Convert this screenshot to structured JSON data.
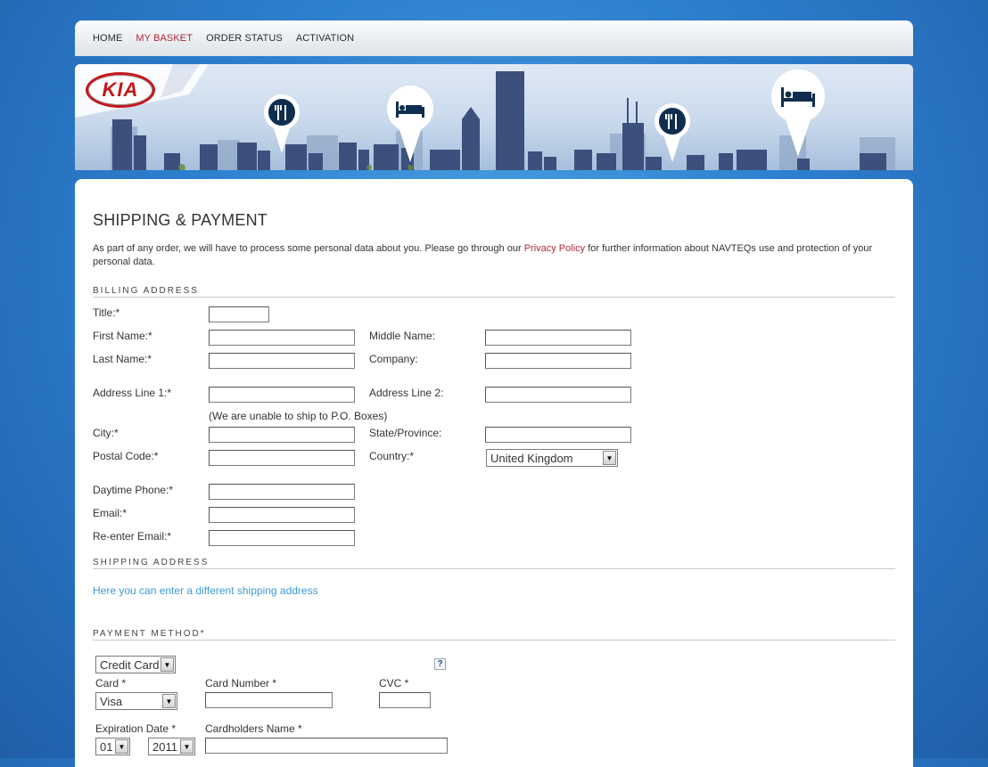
{
  "nav": {
    "items": [
      {
        "label": "HOME",
        "active": false
      },
      {
        "label": "MY BASKET",
        "active": true
      },
      {
        "label": "ORDER STATUS",
        "active": false
      },
      {
        "label": "ACTIVATION",
        "active": false
      }
    ]
  },
  "banner": {
    "logo_text": "KIA"
  },
  "page": {
    "title": "SHIPPING & PAYMENT",
    "intro_before": "As part of any order, we will have to process some personal data about you. Please go through our ",
    "intro_link": "Privacy Policy",
    "intro_after": " for further information about NAVTEQs use and protection of your personal data."
  },
  "billing": {
    "heading": "BILLING ADDRESS",
    "title_label": "Title:*",
    "first_name_label": "First Name:*",
    "middle_name_label": "Middle Name:",
    "last_name_label": "Last Name:*",
    "company_label": "Company:",
    "address1_label": "Address Line 1:*",
    "address2_label": "Address Line 2:",
    "po_note": "(We are unable to ship to P.O. Boxes)",
    "city_label": "City:*",
    "state_label": "State/Province:",
    "postal_label": "Postal Code:*",
    "country_label": "Country:*",
    "country_value": "United Kingdom",
    "phone_label": "Daytime Phone:*",
    "email_label": "Email:*",
    "reemail_label": "Re-enter Email:*"
  },
  "shipping": {
    "heading": "SHIPPING ADDRESS",
    "link": "Here you can enter a different shipping address"
  },
  "payment": {
    "heading": "PAYMENT METHOD*",
    "method_value": "Credit Card",
    "help": "?",
    "card_label": "Card *",
    "card_value": "Visa",
    "card_number_label": "Card Number *",
    "cvc_label": "CVC *",
    "expiration_label": "Expiration Date *",
    "exp_month": "01",
    "exp_year": "2011",
    "cardholder_label": "Cardholders Name *"
  }
}
